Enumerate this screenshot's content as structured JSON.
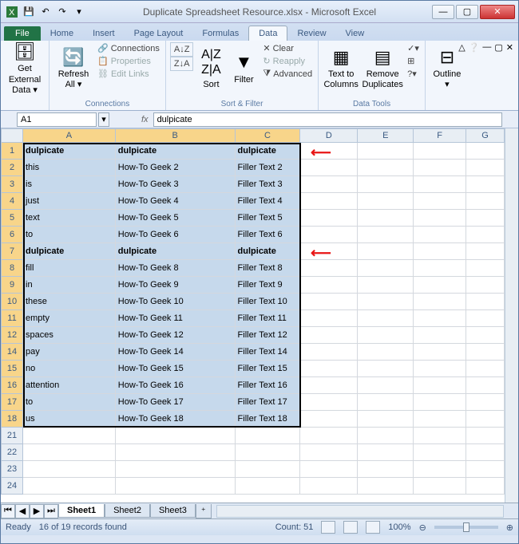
{
  "title": "Duplicate Spreadsheet Resource.xlsx  -  Microsoft Excel",
  "tabs": [
    "File",
    "Home",
    "Insert",
    "Page Layout",
    "Formulas",
    "Data",
    "Review",
    "View"
  ],
  "active_tab": "Data",
  "ribbon": {
    "get_external": "Get External\nData ▾",
    "refresh": "Refresh\nAll ▾",
    "connections": "Connections",
    "properties": "Properties",
    "edit_links": "Edit Links",
    "sort": "Sort",
    "filter": "Filter",
    "clear": "Clear",
    "reapply": "Reapply",
    "advanced": "Advanced",
    "text_to_cols": "Text to\nColumns",
    "remove_dup": "Remove\nDuplicates",
    "outline": "Outline\n▾",
    "grp_connections": "Connections",
    "grp_sortfilter": "Sort & Filter",
    "grp_datatools": "Data Tools"
  },
  "namebox": "A1",
  "formula": "dulpicate",
  "col_headers": [
    "A",
    "B",
    "C",
    "D",
    "E",
    "F",
    "G"
  ],
  "sel_cols": [
    "A",
    "B",
    "C"
  ],
  "rows": [
    {
      "n": 1,
      "sel": true,
      "bold": true,
      "c": [
        "dulpicate",
        "dulpicate",
        "dulpicate"
      ]
    },
    {
      "n": 2,
      "sel": true,
      "c": [
        "this",
        "How-To Geek  2",
        "Filler Text 2"
      ]
    },
    {
      "n": 3,
      "sel": true,
      "c": [
        "is",
        "How-To Geek  3",
        "Filler Text 3"
      ]
    },
    {
      "n": 4,
      "sel": true,
      "c": [
        "just",
        "How-To Geek  4",
        "Filler Text 4"
      ]
    },
    {
      "n": 5,
      "sel": true,
      "c": [
        "text",
        "How-To Geek  5",
        "Filler Text 5"
      ]
    },
    {
      "n": 6,
      "sel": true,
      "c": [
        "to",
        "How-To Geek  6",
        "Filler Text 6"
      ]
    },
    {
      "n": 7,
      "sel": true,
      "bold": true,
      "c": [
        "dulpicate",
        "dulpicate",
        "dulpicate"
      ]
    },
    {
      "n": 8,
      "sel": true,
      "c": [
        "fill",
        "How-To Geek  8",
        "Filler Text 8"
      ]
    },
    {
      "n": 9,
      "sel": true,
      "c": [
        "in",
        "How-To Geek  9",
        "Filler Text 9"
      ]
    },
    {
      "n": 10,
      "sel": true,
      "c": [
        "these",
        "How-To Geek  10",
        "Filler Text 10"
      ]
    },
    {
      "n": 11,
      "sel": true,
      "c": [
        "empty",
        "How-To Geek  11",
        "Filler Text 11"
      ]
    },
    {
      "n": 12,
      "sel": true,
      "c": [
        "spaces",
        "How-To Geek  12",
        "Filler Text 12"
      ]
    },
    {
      "n": 14,
      "sel": true,
      "c": [
        "pay",
        "How-To Geek  14",
        "Filler Text 14"
      ]
    },
    {
      "n": 15,
      "sel": true,
      "c": [
        "no",
        "How-To Geek  15",
        "Filler Text 15"
      ]
    },
    {
      "n": 16,
      "sel": true,
      "c": [
        "attention",
        "How-To Geek  16",
        "Filler Text 16"
      ]
    },
    {
      "n": 17,
      "sel": true,
      "c": [
        "to",
        "How-To Geek  17",
        "Filler Text 17"
      ]
    },
    {
      "n": 18,
      "sel": true,
      "c": [
        "us",
        "How-To Geek  18",
        "Filler Text 18"
      ]
    },
    {
      "n": 21,
      "c": [
        "",
        "",
        ""
      ]
    },
    {
      "n": 22,
      "c": [
        "",
        "",
        ""
      ]
    },
    {
      "n": 23,
      "c": [
        "",
        "",
        ""
      ]
    },
    {
      "n": 24,
      "c": [
        "",
        "",
        ""
      ]
    }
  ],
  "sheets": [
    "Sheet1",
    "Sheet2",
    "Sheet3"
  ],
  "active_sheet": "Sheet1",
  "status": {
    "ready": "Ready",
    "records": "16 of 19 records found",
    "count": "Count: 51",
    "zoom": "100%"
  }
}
